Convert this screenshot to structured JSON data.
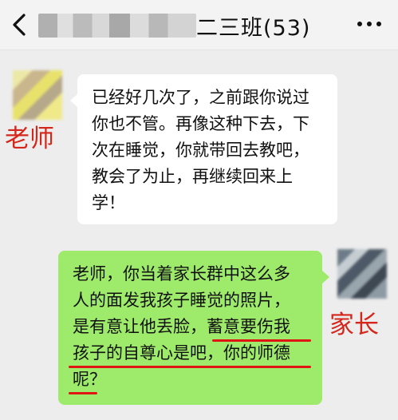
{
  "header": {
    "title": "二三班(53)",
    "back_icon": "back-chevron-icon",
    "more_icon": "more-dots-icon"
  },
  "messages": [
    {
      "sender_label": "老师",
      "side": "left",
      "lines": [
        "已经好几次了，之前跟你说过",
        "你也不管。再像这种下去，下",
        "次在睡觉，你就带回去教吧，",
        "教会了为止，再继续回来上",
        "学！"
      ]
    },
    {
      "sender_label": "家长",
      "side": "right",
      "lines": [
        "老师，你当着家长群中这么多",
        "人的面发我孩子睡觉的照片，",
        "是有意让他丢脸，蓄意要伤我",
        "孩子的自尊心是吧，你的师德",
        "呢？"
      ]
    }
  ],
  "colors": {
    "left_bubble": "#ffffff",
    "right_bubble": "#9eea6a",
    "annotation_red": "#d4261b"
  }
}
